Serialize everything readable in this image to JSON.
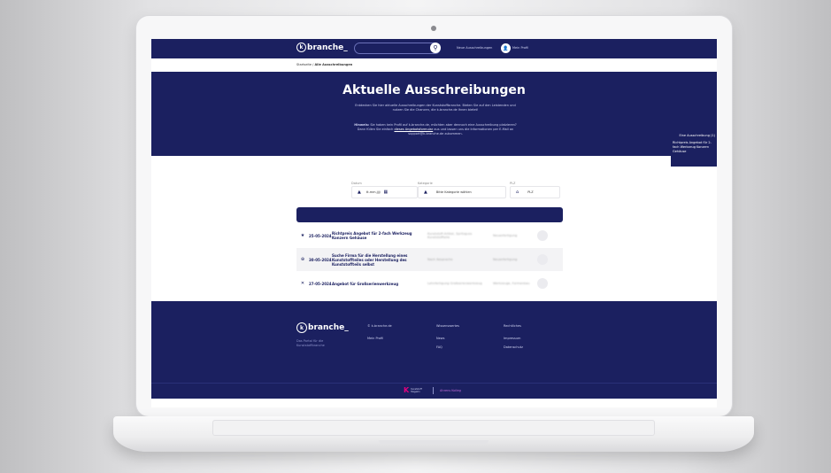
{
  "header": {
    "logo_letter": "k",
    "logo_text": "branche",
    "logo_suffix": "_",
    "search_placeholder": "",
    "search_icon_glyph": "⚲",
    "nav_link": "Neue Ausschreibungen",
    "avatar_glyph": "👤",
    "profile_link": "Mein Profil"
  },
  "breadcrumb": {
    "home": "Startseite /",
    "current": "Alle Ausschreibungen"
  },
  "hero": {
    "title": "Aktuelle Ausschreibungen",
    "text1": "Entdecken Sie hier aktuelle Ausschreibungen der Kunststoffbranche. Bieten Sie auf den Leistenden und nutzen Sie die Chancen, die k-branche.de Ihnen bietet!",
    "text2_bold": "Hinweis:",
    "text2": " Sie haben kein Profil auf k-branche.de, möchten aber dennoch eine Ausschreibung platzieren? Dann füllen Sie einfach",
    "text2_link": "dieses Angebotsformular",
    "text2_end": " aus und lassen uns die Informationen per E-Mail an support@k-branche.de zukommen."
  },
  "side_panel": {
    "title": "Eine Ausschreibung (1)",
    "items": [
      "Richtpreis Angebot für 2-fach Werkzeug Konzern Gehäuse"
    ]
  },
  "filters": {
    "date_label": "Datum",
    "date_value": "tt.mm.jjjj",
    "category_label": "Kategorie",
    "category_value": "Bitte Kategorie wählen",
    "plz_label": "PLZ",
    "plz_value": "PLZ"
  },
  "rows": [
    {
      "icon": "★",
      "date": "25-05-2024",
      "title": "Richtpreis Angebot für 2-fach Werkzeug Konzern Gehäuse",
      "category": "Kunststoff-Artikel, Spritzguss Kunststoffteile",
      "status": "Neuanfertigung"
    },
    {
      "icon": "⊕",
      "date": "30-05-2024",
      "title": "Suche Firma für die Herstellung eines Kunststoffteiles oder Herstellung des Kunststoffteils selbst",
      "category": "Nach Absprache",
      "status": "Neuanfertigung"
    },
    {
      "icon": "✕",
      "date": "27-05-2024",
      "title": "Angebot für Großserienwerkzeug",
      "category": "Lohnfertigung Großserienwerkzeug",
      "status": "Werkzeuge, Formenbau"
    }
  ],
  "footer": {
    "logo_letter": "k",
    "logo_text": "branche",
    "logo_suffix": "_",
    "tagline": "Das Portal für die Kunststoffbranche",
    "col1": [
      "© k-branche.de",
      "Mein Profil"
    ],
    "col2": [
      "Wissenswertes",
      "News",
      "FAQ"
    ],
    "col3": [
      "Rechtliches",
      "Impressum",
      "Datenschutz"
    ],
    "partner1_logo": "K",
    "partner1_text": "Kunststoff Magazin",
    "partner2": "Ahrens Kolleg"
  },
  "colors": {
    "primary": "#1b2060",
    "accent_pink": "#e4007d"
  }
}
